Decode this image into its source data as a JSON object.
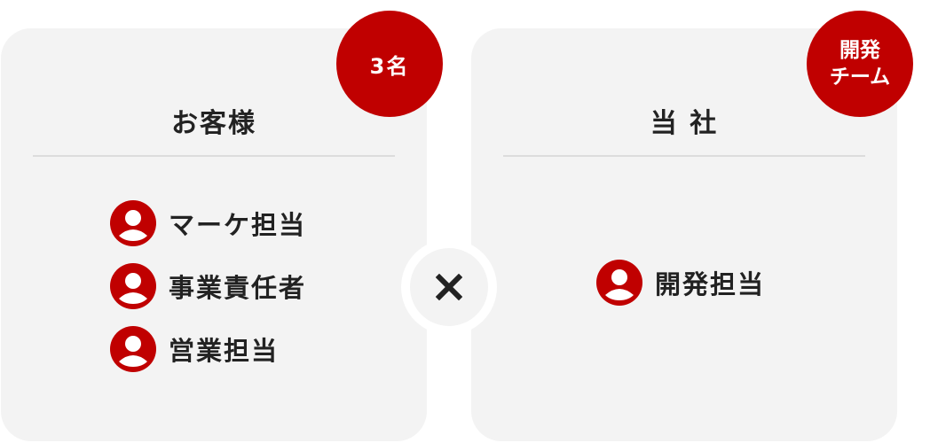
{
  "left_panel": {
    "title": "お客様",
    "badge": "3名",
    "roles": [
      {
        "label": "マーケ担当",
        "icon": "person-icon"
      },
      {
        "label": "事業責任者",
        "icon": "person-icon"
      },
      {
        "label": "営業担当",
        "icon": "person-icon"
      }
    ]
  },
  "right_panel": {
    "title": "当 社",
    "badge_lines": [
      "開発",
      "チーム"
    ],
    "roles": [
      {
        "label": "開発担当",
        "icon": "person-icon"
      }
    ]
  },
  "connector": {
    "icon": "multiply-icon"
  },
  "colors": {
    "accent": "#c00000",
    "card_background": "#f3f3f3",
    "text": "#222222",
    "divider": "#dcdcdc"
  }
}
